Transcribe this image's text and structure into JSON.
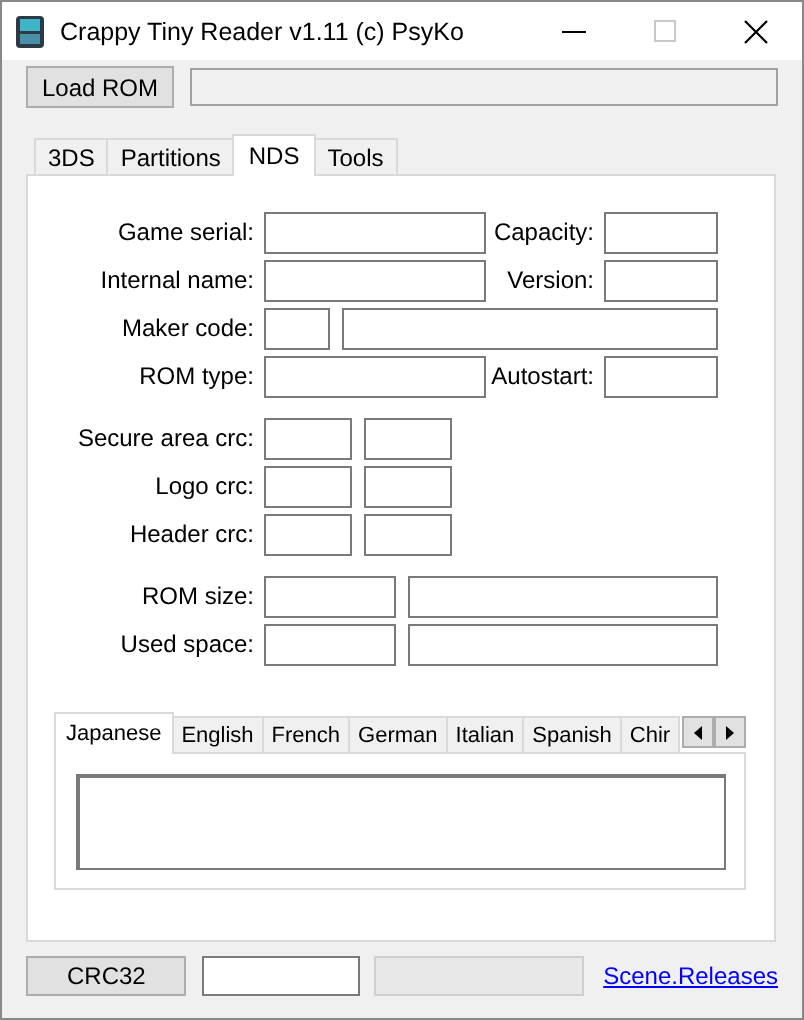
{
  "window": {
    "title": "Crappy Tiny Reader v1.11 (c) PsyKo"
  },
  "load_button": "Load ROM",
  "tabs": [
    {
      "label": "3DS",
      "selected": false
    },
    {
      "label": "Partitions",
      "selected": false
    },
    {
      "label": "NDS",
      "selected": true
    },
    {
      "label": "Tools",
      "selected": false
    }
  ],
  "groups": [
    [
      {
        "kind": "pair",
        "label": "Game serial:",
        "side_label": "Capacity:"
      },
      {
        "kind": "pair",
        "label": "Internal name:",
        "side_label": "Version:"
      },
      {
        "kind": "code",
        "label": "Maker code:"
      },
      {
        "kind": "pair",
        "label": "ROM type:",
        "side_label": "Autostart:"
      }
    ],
    [
      {
        "kind": "crc",
        "label": "Secure area crc:"
      },
      {
        "kind": "crc",
        "label": "Logo crc:"
      },
      {
        "kind": "crc",
        "label": "Header crc:"
      }
    ],
    [
      {
        "kind": "size",
        "label": "ROM size:"
      },
      {
        "kind": "size",
        "label": "Used space:"
      }
    ]
  ],
  "language_tabs": [
    {
      "label": "Japanese",
      "selected": true
    },
    {
      "label": "English",
      "selected": false
    },
    {
      "label": "French",
      "selected": false
    },
    {
      "label": "German",
      "selected": false
    },
    {
      "label": "Italian",
      "selected": false
    },
    {
      "label": "Spanish",
      "selected": false
    },
    {
      "label": "Chir",
      "selected": false
    }
  ],
  "crc_button": "CRC32",
  "link": "Scene.Releases"
}
